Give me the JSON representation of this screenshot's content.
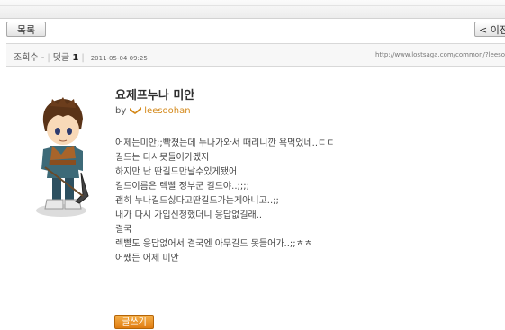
{
  "nav": {
    "list_label": "목록",
    "prev_label": "< 이전"
  },
  "info": {
    "views_label": "조회수 -",
    "comments_label": "덧글",
    "comments_count": "1",
    "date": "2011-05-04 09:25",
    "url": "http://www.lostsaga.com/common/?leesoohan"
  },
  "post": {
    "title": "요제프누나 미안",
    "by": "by",
    "author": "leesoohan",
    "lines": [
      "어제는미안;;빡쳤는데 누나가와서 때리니깐 욕먹었네..ㄷㄷ",
      "길드는 다시못들어가겠지",
      "하지만 난 딴길드만날수있게됐어",
      "길드이름은 렉빨 정부군 길드야..;;;;",
      "괜히 누나길드싫다고딴길드가는게아니고..;;",
      "내가 다시 가입신청했더니 응답없길래..",
      "결국",
      "렉빨도 응답없어서 결국엔 아무길드 못들어가..;;ㅎㅎ",
      "어쨌든 어제 미안"
    ]
  },
  "actions": {
    "write_label": "글쓰기"
  },
  "colors": {
    "author": "#d4891a",
    "write_button": "#e88a1a"
  }
}
